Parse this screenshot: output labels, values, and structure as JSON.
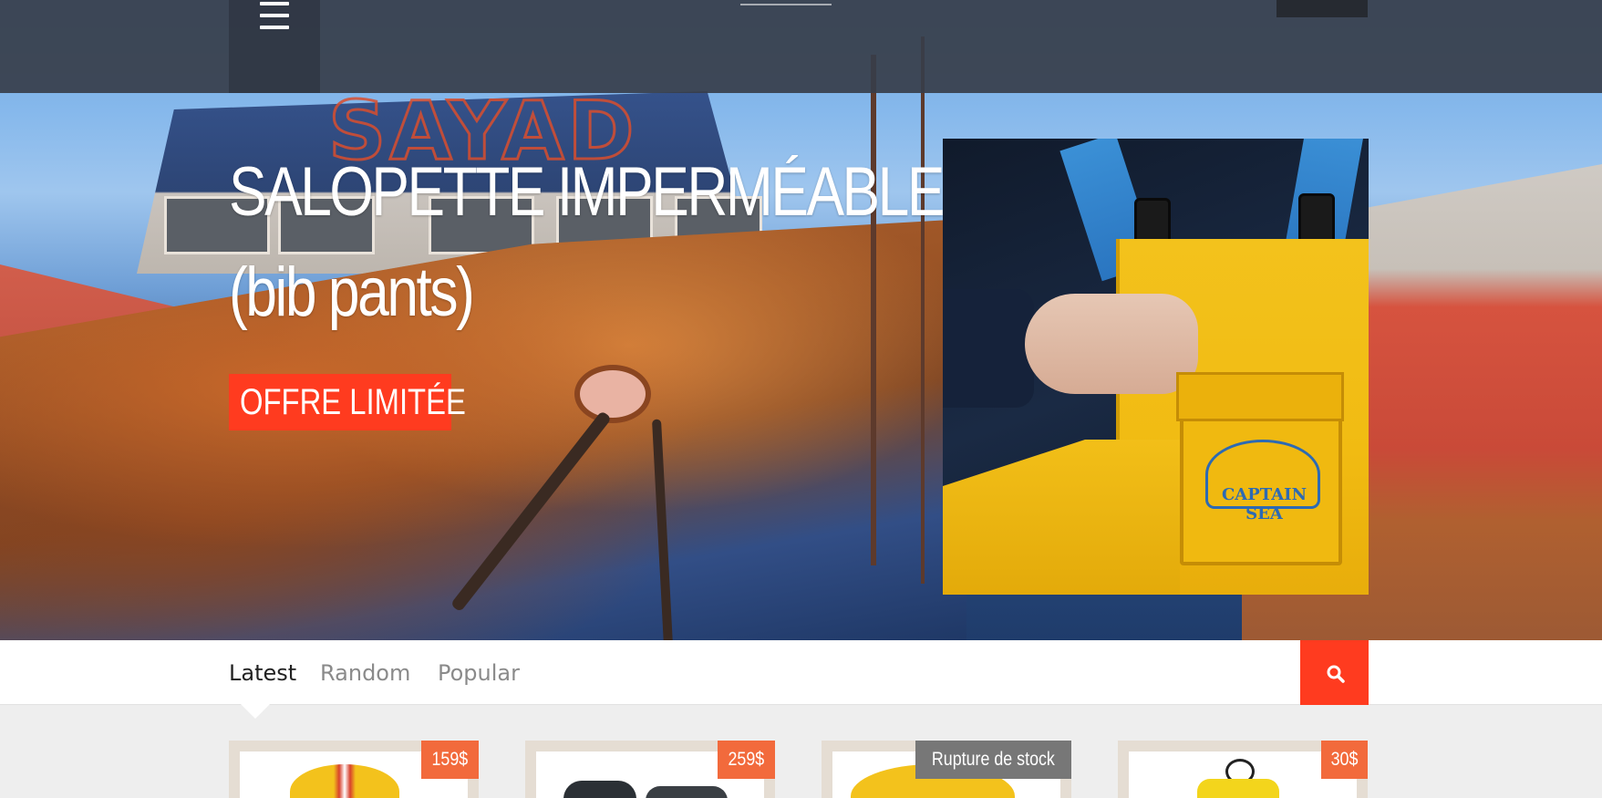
{
  "header": {
    "menu_icon": "hamburger-menu-icon"
  },
  "slide": {
    "title_line1": "SALOPETTE IMPERMÉABLE",
    "title_line2": "(bib pants)",
    "cta_label": "OFFRE LIMITÉE",
    "product_logo_text": "CAPTAIN SEA"
  },
  "tabs": [
    {
      "label": "Latest",
      "active": true
    },
    {
      "label": "Random",
      "active": false
    },
    {
      "label": "Popular",
      "active": false
    }
  ],
  "search": {
    "icon": "search-icon"
  },
  "products": [
    {
      "badge": "159$",
      "badge_type": "price"
    },
    {
      "badge": "259$",
      "badge_type": "price"
    },
    {
      "badge": "Rupture de stock",
      "badge_type": "stock"
    },
    {
      "badge": "30$",
      "badge_type": "price"
    }
  ],
  "colors": {
    "accent": "#ff3b1f",
    "price_badge": "#f26a3c",
    "stock_badge": "#777777",
    "header": "#373e4a"
  }
}
